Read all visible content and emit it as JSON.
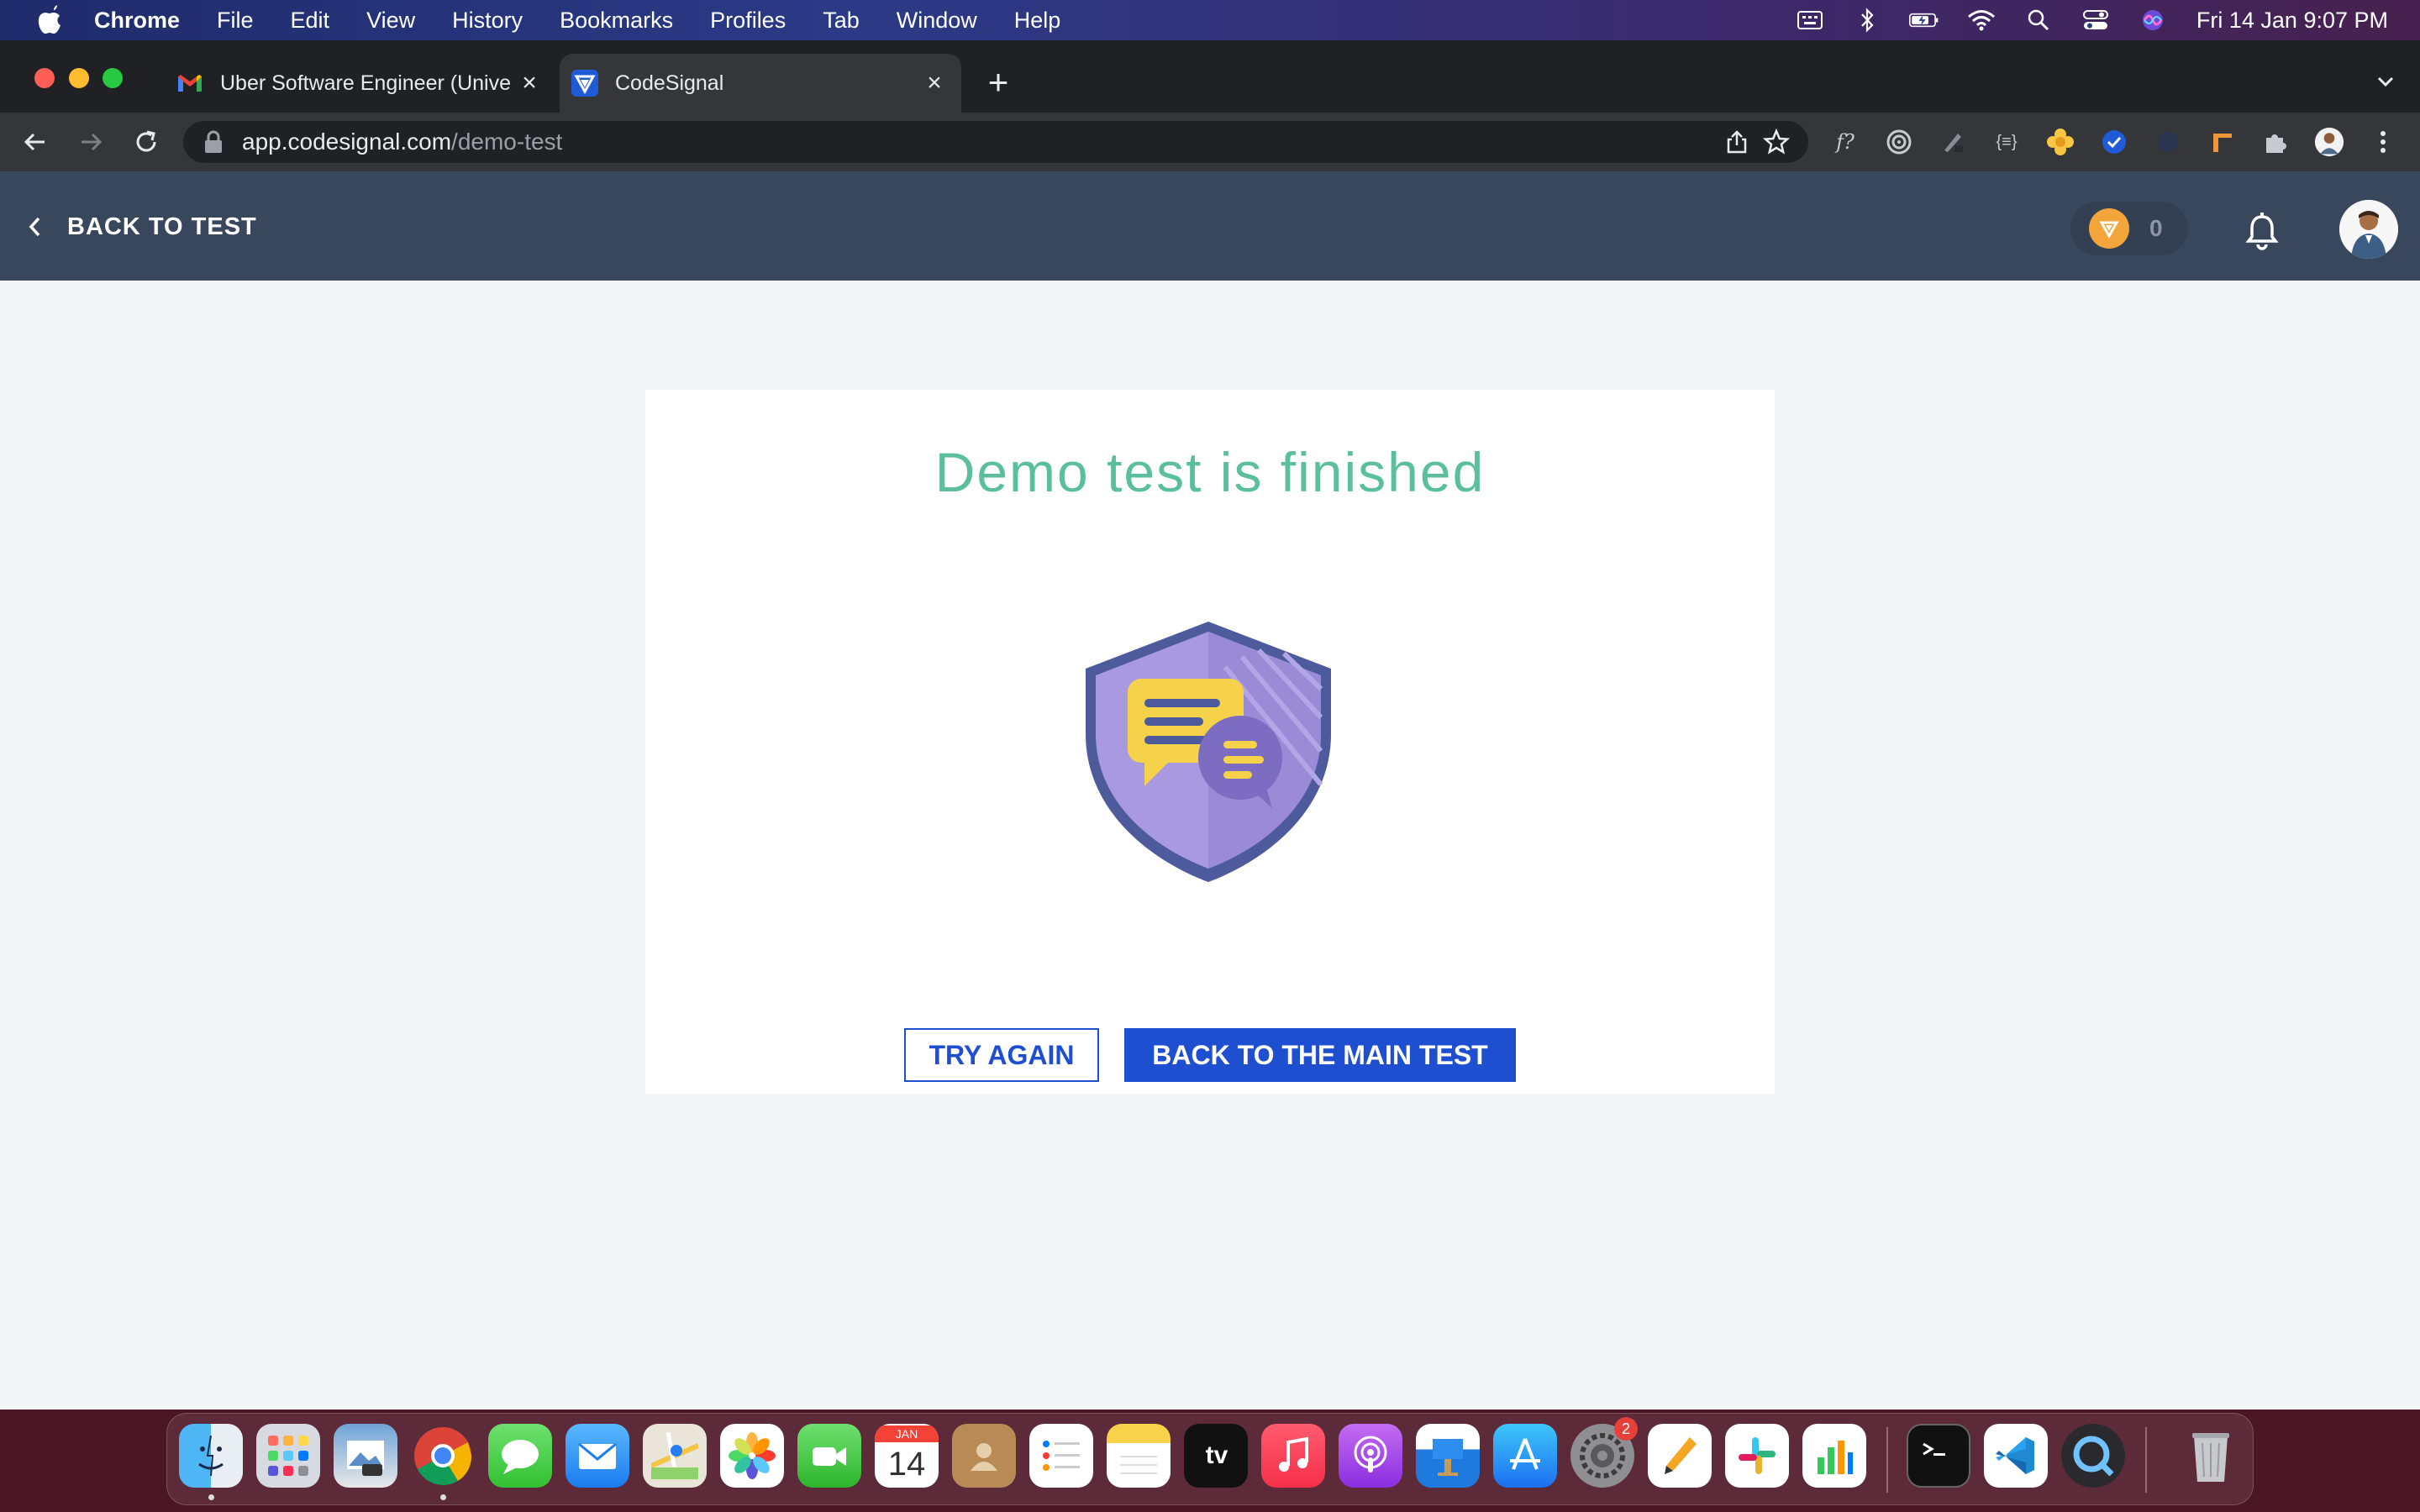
{
  "menubar": {
    "app_name": "Chrome",
    "menus": [
      "File",
      "Edit",
      "View",
      "History",
      "Bookmarks",
      "Profiles",
      "Tab",
      "Window",
      "Help"
    ],
    "clock": "Fri 14 Jan  9:07 PM"
  },
  "browser": {
    "tabs": [
      {
        "title": "Uber Software Engineer (Unive",
        "icon": "gmail-icon",
        "active": false
      },
      {
        "title": "CodeSignal",
        "icon": "codesignal-icon",
        "active": true
      }
    ],
    "url_host": "app.codesignal.com",
    "url_path": "/demo-test"
  },
  "app": {
    "back_label": "BACK TO TEST",
    "coin_count": "0",
    "accent": "#1f4fd1",
    "header_bg": "#39475c"
  },
  "result": {
    "title": "Demo test is finished",
    "try_again_label": "TRY AGAIN",
    "main_test_label": "BACK TO THE MAIN TEST",
    "title_color": "#5bbf9e"
  },
  "dock": {
    "calendar_month": "JAN",
    "calendar_day": "14",
    "tv_label": "tv",
    "settings_badge": "2",
    "apps": [
      "Finder",
      "Launchpad",
      "Preview",
      "Chrome",
      "Messages",
      "Mail",
      "Maps",
      "Photos",
      "FaceTime",
      "Calendar",
      "Contacts",
      "Reminders",
      "Notes",
      "TV",
      "Music",
      "Podcasts",
      "Keynote",
      "App Store",
      "System Preferences",
      "Pages",
      "Slack",
      "Numbers",
      "Terminal",
      "VS Code",
      "QuickTime",
      "Trash"
    ]
  }
}
